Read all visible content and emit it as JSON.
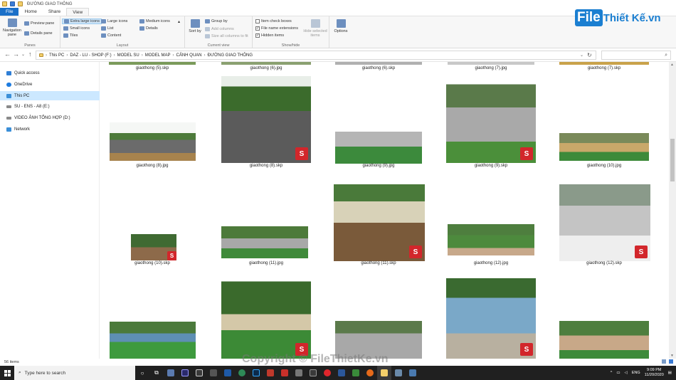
{
  "window": {
    "title": "ĐƯỜNG GIAO THÔNG"
  },
  "ribbon": {
    "tabs": [
      {
        "label": "File"
      },
      {
        "label": "Home"
      },
      {
        "label": "Share"
      },
      {
        "label": "View"
      }
    ],
    "panes": {
      "navigation_pane": "Navigation pane",
      "preview_pane": "Preview pane",
      "details_pane": "Details pane",
      "label": "Panes"
    },
    "layout": {
      "items": [
        "Extra large icons",
        "Large icons",
        "Medium icons",
        "Small icons",
        "List",
        "Details",
        "Tiles",
        "Content"
      ],
      "label": "Layout"
    },
    "current_view": {
      "sort_by": "Sort by",
      "group_by": "Group by",
      "add_columns": "Add columns",
      "size_all": "Size all columns to fit",
      "label": "Current view"
    },
    "show_hide": {
      "item_check_boxes": "Item check boxes",
      "file_name_extensions": "File name extensions",
      "hidden_items": "Hidden items",
      "hide_selected": "Hide selected items",
      "label": "Show/hide"
    },
    "options": {
      "label": "Options"
    }
  },
  "logo": {
    "part1": "File",
    "part2": "Thiết Kế.vn"
  },
  "address": {
    "crumbs": [
      "This PC",
      "DAZ - LU - SHOP (F:)",
      "MODEL SU",
      "MODEL MAP",
      "CẢNH QUAN",
      "ĐƯỜNG GIAO THÔNG"
    ]
  },
  "nav": {
    "items": [
      "Quick access",
      "OneDrive",
      "This PC",
      "SU - ENS - A8 (E:)",
      "VIDEO ẢNH TỔNG HỢP (D:)",
      "Network"
    ]
  },
  "files": {
    "row0": [
      "giaothong (5).skp",
      "giaothong (6).jpg",
      "giaothong (6).skp",
      "giaothong (7).jpg",
      "giaothong (7).skp"
    ],
    "row1": [
      "giaothong (8).jpg",
      "giaothong (8).skp",
      "giaothong (9).jpg",
      "giaothong (9).skp",
      "giaothong (10).jpg"
    ],
    "row2": [
      "giaothong (10).skp",
      "giaothong (11).jpg",
      "giaothong (11).skp",
      "giaothong (12).jpg",
      "giaothong (12).skp"
    ]
  },
  "status": {
    "count": "56 items"
  },
  "watermark": "Copyright © FileThietKe.vn",
  "taskbar": {
    "search_placeholder": "Type here to search",
    "lang": "ENG",
    "time": "9:09 PM",
    "date": "11/20/2020"
  }
}
